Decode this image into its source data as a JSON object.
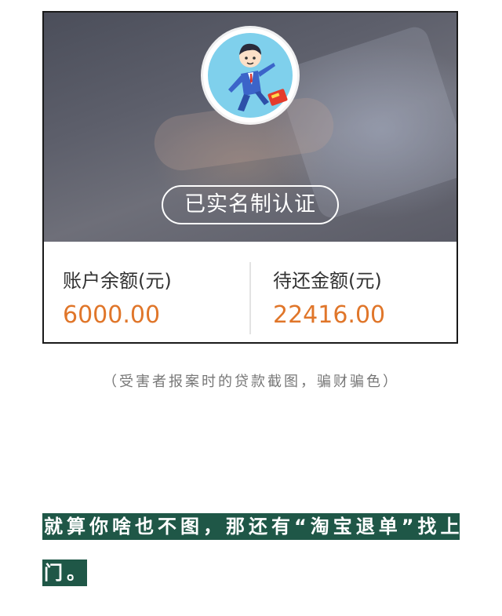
{
  "card": {
    "verify_label": "已实名制认证",
    "stats": [
      {
        "label": "账户余额(元)",
        "value": "6000.00"
      },
      {
        "label": "待还金额(元)",
        "value": "22416.00"
      }
    ],
    "value_color": "#e0762a",
    "avatar_icon": "businessman-running-avatar-icon"
  },
  "caption": "（受害者报案时的贷款截图，骗财骗色）",
  "article": {
    "highlight_line_1": "就算你啥也不图，那还有“淘宝退单”找上",
    "highlight_line_2": "门。",
    "highlight_color": "#1f5747"
  }
}
